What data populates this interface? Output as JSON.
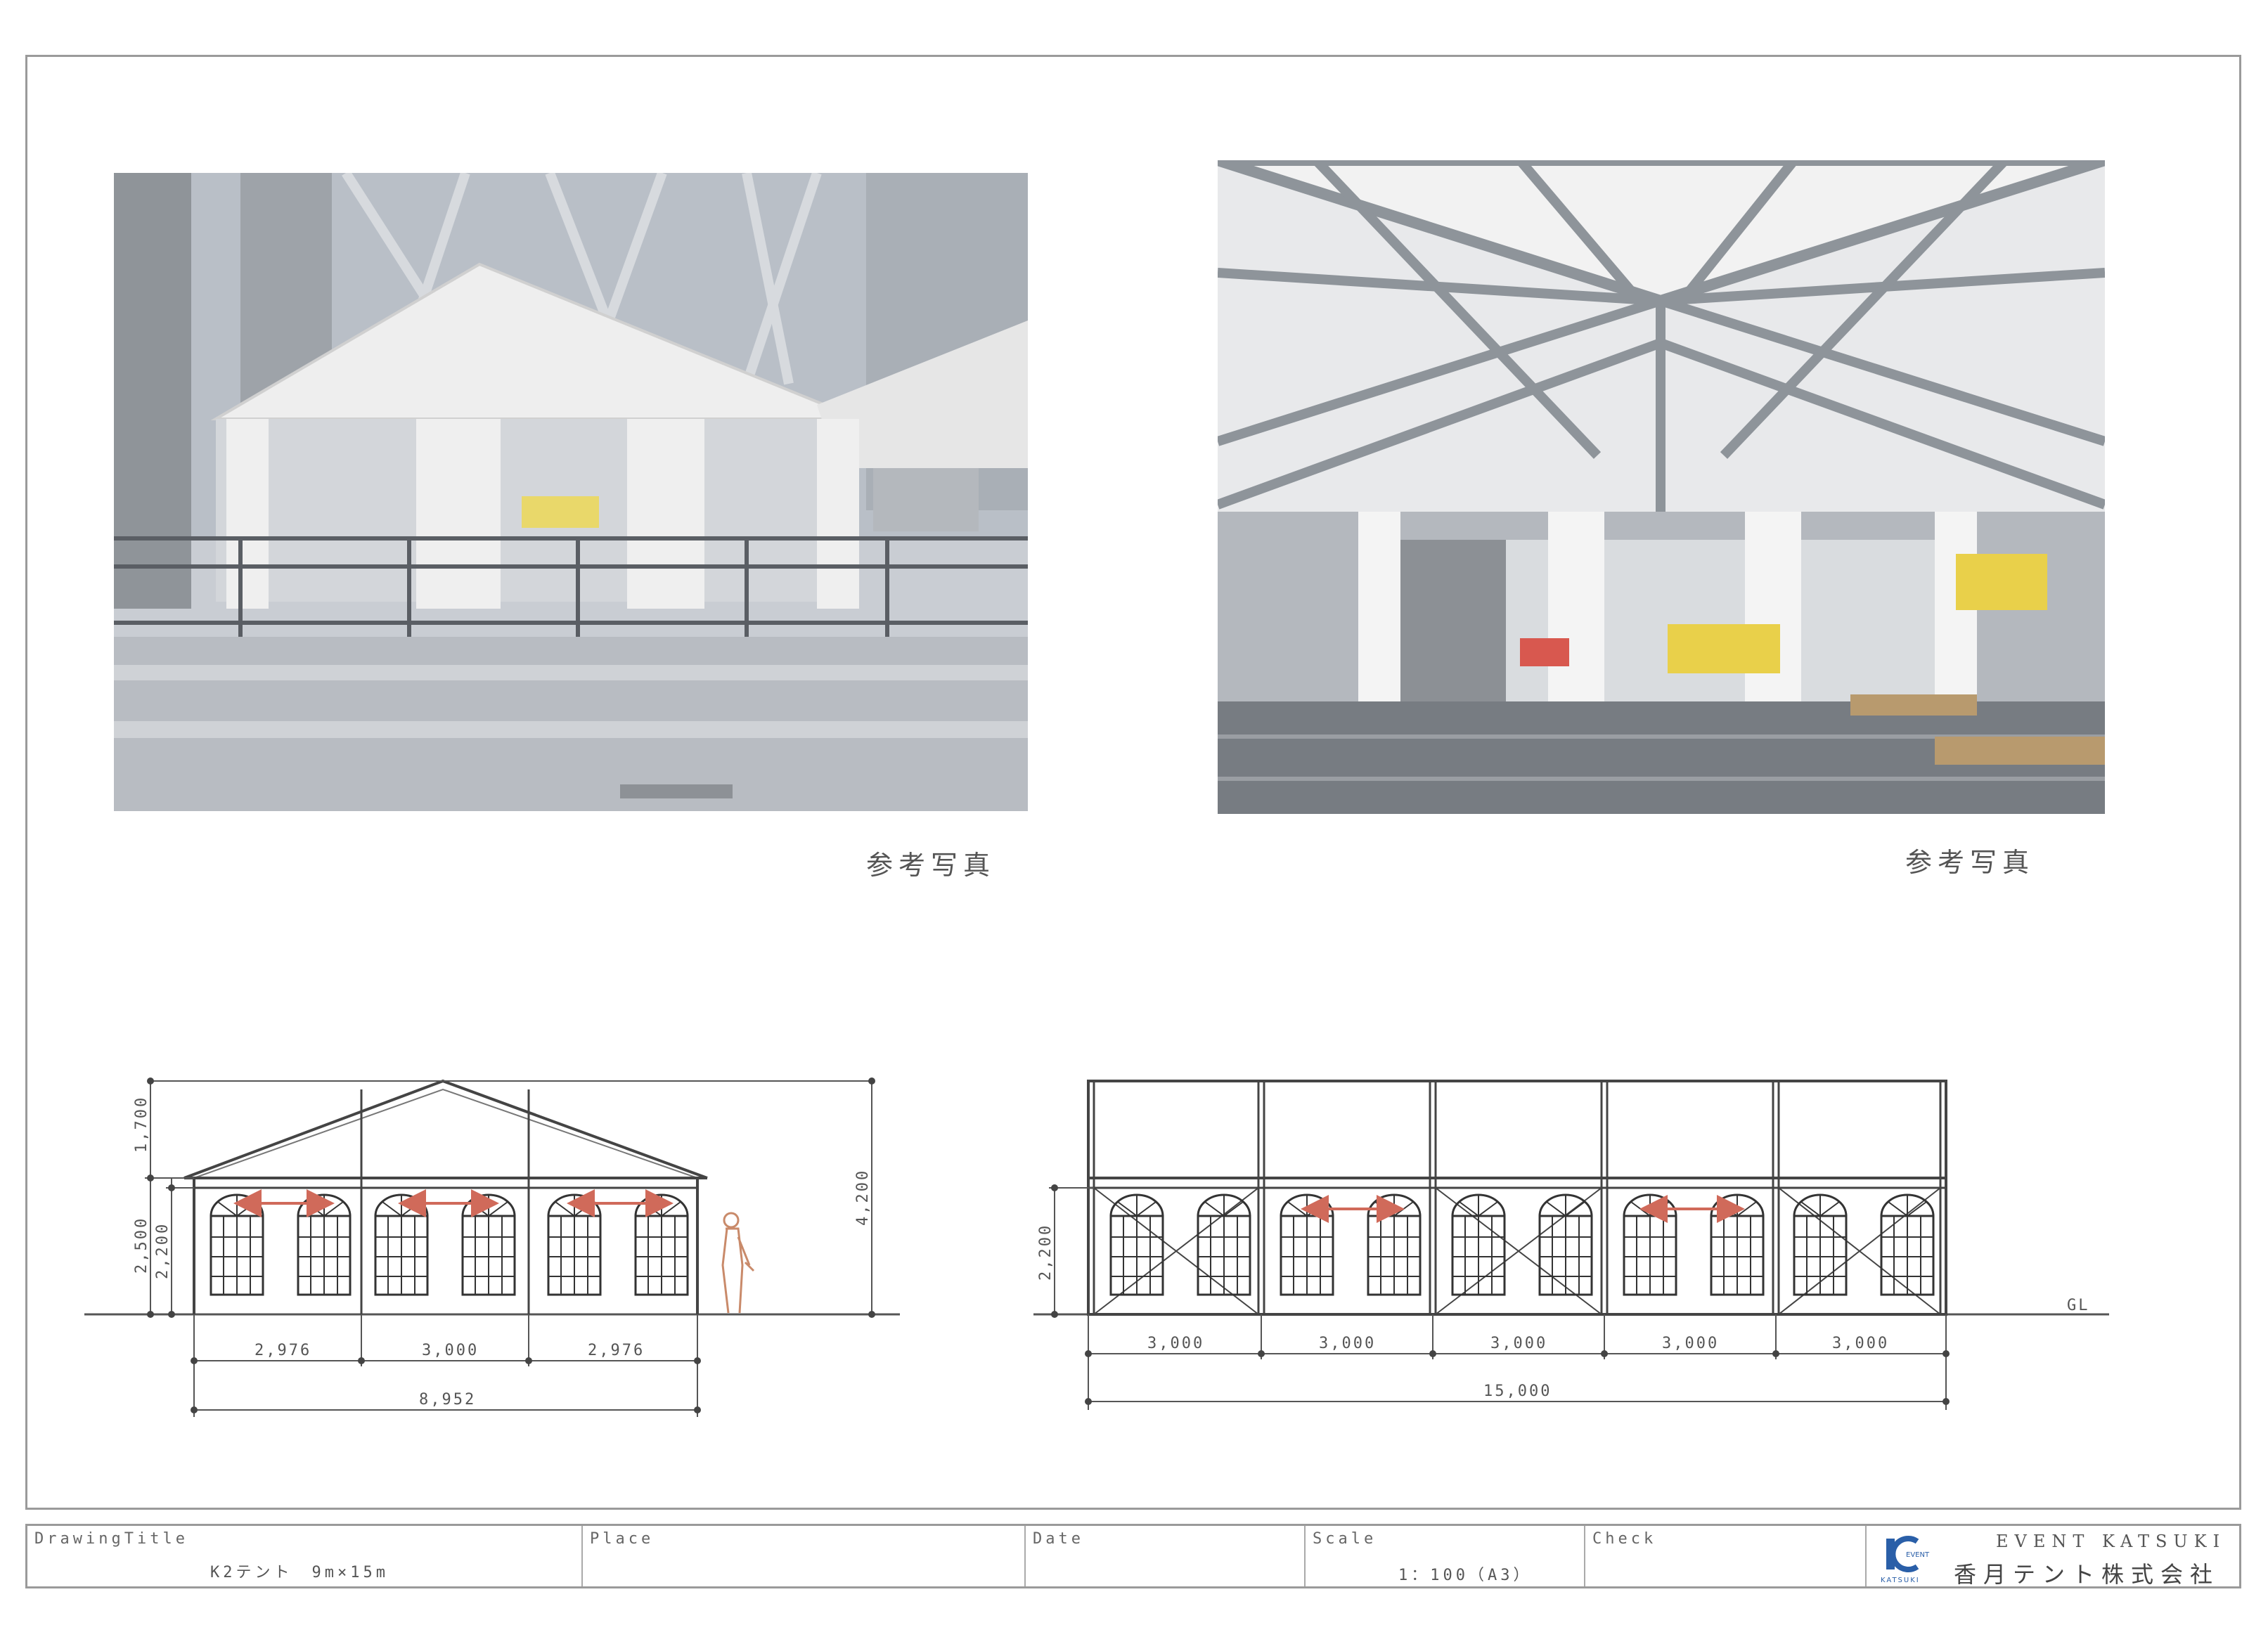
{
  "photos": {
    "left_caption": "参考写真",
    "right_caption": "参考写真"
  },
  "front_elevation": {
    "dims_vertical": [
      "1,700",
      "2,500",
      "2,200",
      "4,200"
    ],
    "dims_bays": [
      "2,976",
      "3,000",
      "2,976"
    ],
    "dim_total": "8,952"
  },
  "side_elevation": {
    "dims_vertical": [
      "2,200"
    ],
    "dims_bays": [
      "3,000",
      "3,000",
      "3,000",
      "3,000",
      "3,000"
    ],
    "dim_total": "15,000",
    "ground_label": "GL"
  },
  "title_block": {
    "drawing_title_label": "DrawingTitle",
    "drawing_title_value": "K2テント　9m×15m",
    "place_label": "Place",
    "date_label": "Date",
    "scale_label": "Scale",
    "scale_value": "1：100（A3）",
    "check_label": "Check",
    "company_en": "EVENT KATSUKI",
    "company_jp": "香月テント株式会社",
    "logo_text": "KATSUKI"
  },
  "colors": {
    "frame": "#9a9a9a",
    "line": "#555555",
    "arrow": "#d06a5a",
    "logo": "#2a5fa8"
  }
}
